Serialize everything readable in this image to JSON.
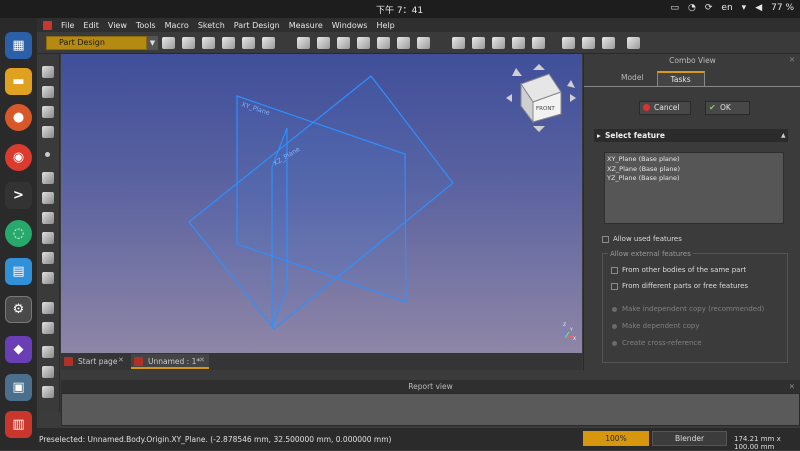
{
  "system_bar": {
    "clock": "下午 7：41",
    "language": "en",
    "battery": "77 %"
  },
  "menu": [
    "File",
    "Edit",
    "View",
    "Tools",
    "Macro",
    "Sketch",
    "Part Design",
    "Measure",
    "Windows",
    "Help"
  ],
  "toolbar": {
    "workbench": "Part Design"
  },
  "viewport": {
    "plane_labels": [
      "XY_Plane",
      "XZ_Plane"
    ],
    "navcube_face": "FRONT",
    "axis_labels": [
      "X",
      "Y",
      "Z"
    ]
  },
  "doc_tabs": [
    {
      "label": "Start page"
    },
    {
      "label": "Unnamed : 1*"
    }
  ],
  "combo": {
    "title": "Combo View",
    "tabs": [
      "Model",
      "Tasks"
    ],
    "cancel": "Cancel",
    "ok": "OK",
    "section_title": "Select feature",
    "features": [
      "XY_Plane (Base plane)",
      "XZ_Plane (Base plane)",
      "YZ_Plane (Base plane)"
    ],
    "allow_used": "Allow used features",
    "external_group": "Allow external features",
    "opt_same_part": "From other bodies of the same part",
    "opt_diff_parts": "From different parts or free features",
    "radio_indep": "Make independent copy (recommended)",
    "radio_dep": "Make dependent copy",
    "radio_cross": "Create cross-reference"
  },
  "report_view": {
    "title": "Report view"
  },
  "status": {
    "message": "Preselected: Unnamed.Body.Origin.XY_Plane. (-2.878546 mm, 32.500000 mm, 0.000000 mm)",
    "zoom": "100%",
    "navigation": "Blender",
    "dimensions": "174.21 mm x 100.00 mm"
  },
  "colors": {
    "accent": "#d6960e",
    "plane_lines": "#2f8fff",
    "viewport_top": "#3f4f9a",
    "viewport_bottom": "#8f86a7"
  },
  "icons": [
    "apps-grid-icon",
    "files-icon",
    "firefox-icon",
    "chrome-icon",
    "terminal-icon",
    "sync-icon",
    "store-icon",
    "freecad-icon",
    "obsidian-icon",
    "screenshot-icon",
    "trash-icon"
  ]
}
